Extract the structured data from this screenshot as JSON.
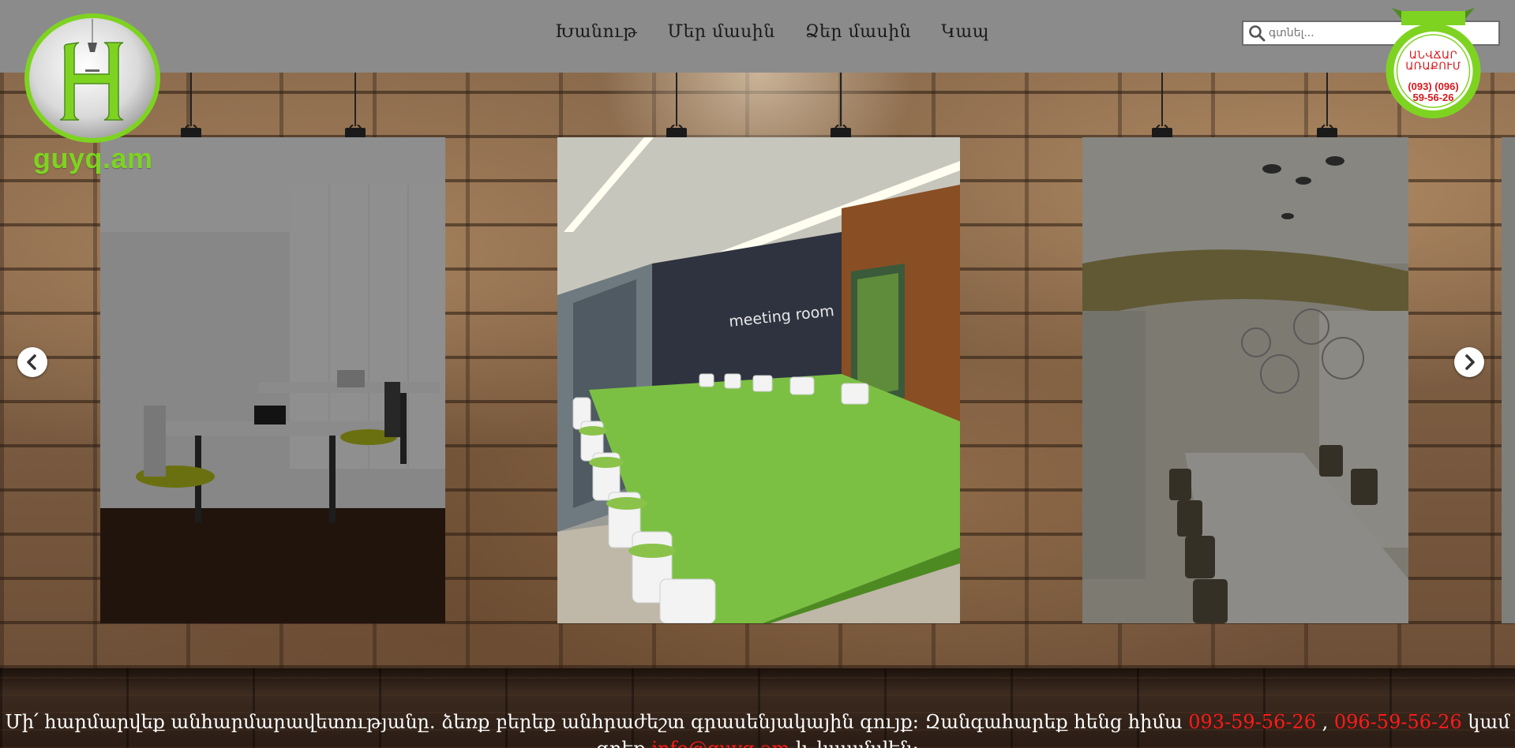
{
  "header": {
    "nav": [
      "Խանութ",
      "Մեր մասին",
      "Ձեր մասին",
      "Կապ"
    ],
    "search_placeholder": "գտնել...",
    "logo_text": "guyq.am"
  },
  "badge": {
    "line1": "ԱՆՎՃԱՐ",
    "line2": "ԱՌԱՔՈՒՄ",
    "phone1": "(093) (096)",
    "phone2": "59-56-26"
  },
  "slider": {
    "slides": [
      "office-workspace",
      "meeting-room",
      "conference-room"
    ],
    "active_index": 1,
    "meeting_room_sign": "meeting room"
  },
  "footer": {
    "text_before": "Մի՛ հարմարվեք անհարմարավետությանը. ձեռք բերեք անհրաժեշտ գրասենյակային գույք: Զանգահարեք հենց հիմա ",
    "phone1": "093-59-56-26",
    "separator": " , ",
    "phone2": "096-59-56-26",
    "text_after": " կամ",
    "line2_before": "գրեք ",
    "email": "info@guyq.am",
    "line2_after": " և կապնվեն:"
  },
  "colors": {
    "brand_green": "#7ed321",
    "header_gray": "#8b8b8b",
    "accent_red": "#ff1a1a"
  }
}
